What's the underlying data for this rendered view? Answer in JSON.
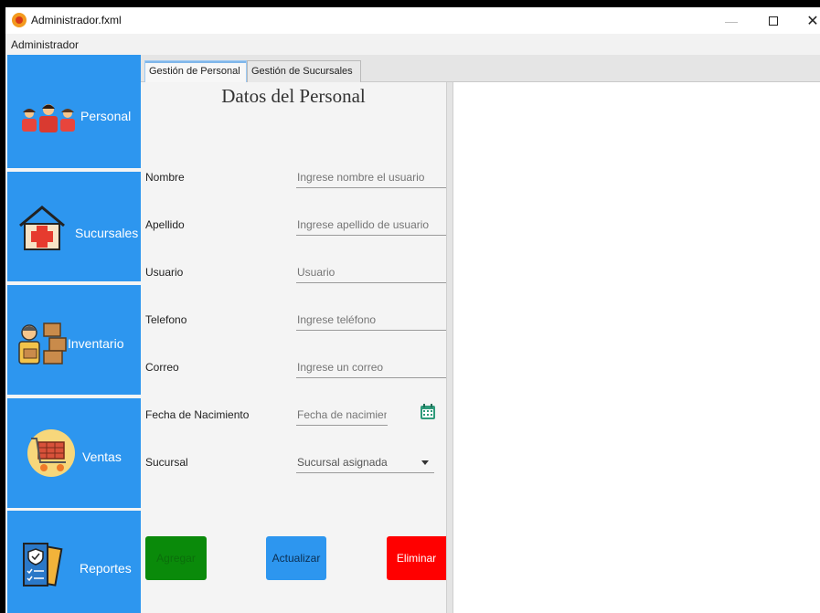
{
  "window": {
    "title": "Administrador.fxml"
  },
  "menubar": {
    "items": [
      "Administrador"
    ]
  },
  "sidebar": {
    "items": [
      {
        "label": "Personal",
        "icon": "team-icon"
      },
      {
        "label": "Sucursales",
        "icon": "hospital-house-icon"
      },
      {
        "label": "Inventario",
        "icon": "worker-boxes-icon"
      },
      {
        "label": "Ventas",
        "icon": "shopping-cart-icon"
      },
      {
        "label": "Reportes",
        "icon": "report-checklist-icon"
      }
    ]
  },
  "tabs": [
    {
      "label": "Gestión de Personal",
      "active": true
    },
    {
      "label": "Gestión de Sucursales",
      "active": false
    }
  ],
  "form": {
    "title": "Datos del Personal",
    "fields": [
      {
        "label": "Nombre",
        "placeholder": "Ingrese nombre el usuario"
      },
      {
        "label": "Apellido",
        "placeholder": "Ingrese apellido de usuario"
      },
      {
        "label": "Usuario",
        "placeholder": "Usuario"
      },
      {
        "label": "Telefono",
        "placeholder": "Ingrese teléfono"
      },
      {
        "label": "Correo",
        "placeholder": "Ingrese un correo"
      },
      {
        "label": "Fecha de Nacimiento",
        "placeholder": "Fecha de nacimiento"
      },
      {
        "label": "Sucursal",
        "placeholder": "Sucursal asignada"
      }
    ],
    "buttons": {
      "agregar": "Agregar",
      "actualizar": "Actualizar",
      "eliminar": "Eliminar"
    }
  },
  "colors": {
    "sidebar": "#2d96ef",
    "agregar": "#0a8a0a",
    "actualizar": "#2d96ef",
    "eliminar": "#ff0000"
  }
}
